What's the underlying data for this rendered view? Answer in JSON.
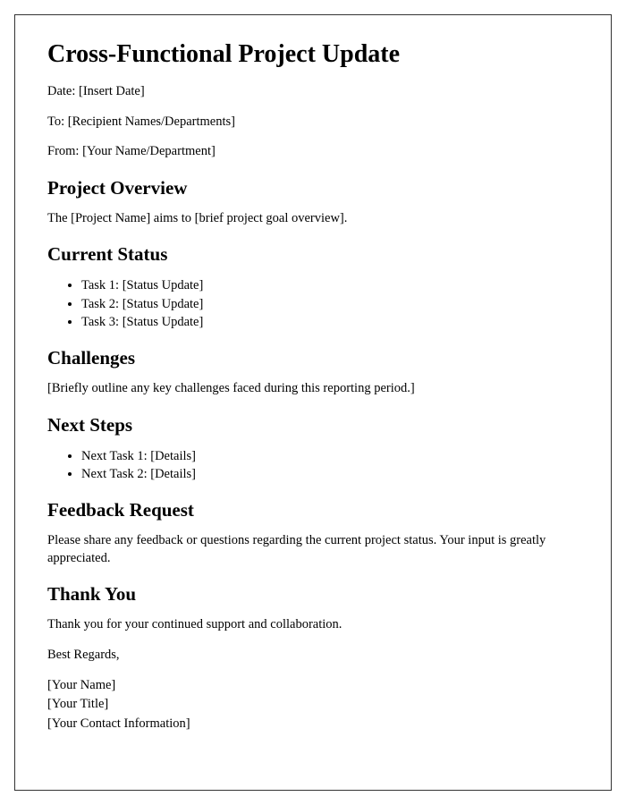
{
  "title": "Cross-Functional Project Update",
  "meta": {
    "date": "Date: [Insert Date]",
    "to": "To: [Recipient Names/Departments]",
    "from": "From: [Your Name/Department]"
  },
  "sections": {
    "overview": {
      "heading": "Project Overview",
      "body": "The [Project Name] aims to [brief project goal overview]."
    },
    "status": {
      "heading": "Current Status",
      "items": [
        "Task 1: [Status Update]",
        "Task 2: [Status Update]",
        "Task 3: [Status Update]"
      ]
    },
    "challenges": {
      "heading": "Challenges",
      "body": "[Briefly outline any key challenges faced during this reporting period.]"
    },
    "next_steps": {
      "heading": "Next Steps",
      "items": [
        "Next Task 1: [Details]",
        "Next Task 2: [Details]"
      ]
    },
    "feedback": {
      "heading": "Feedback Request",
      "body": "Please share any feedback or questions regarding the current project status. Your input is greatly appreciated."
    },
    "thankyou": {
      "heading": "Thank You",
      "body": "Thank you for your continued support and collaboration.",
      "closing": "Best Regards,",
      "signature": {
        "name": "[Your Name]",
        "title": "[Your Title]",
        "contact": "[Your Contact Information]"
      }
    }
  }
}
